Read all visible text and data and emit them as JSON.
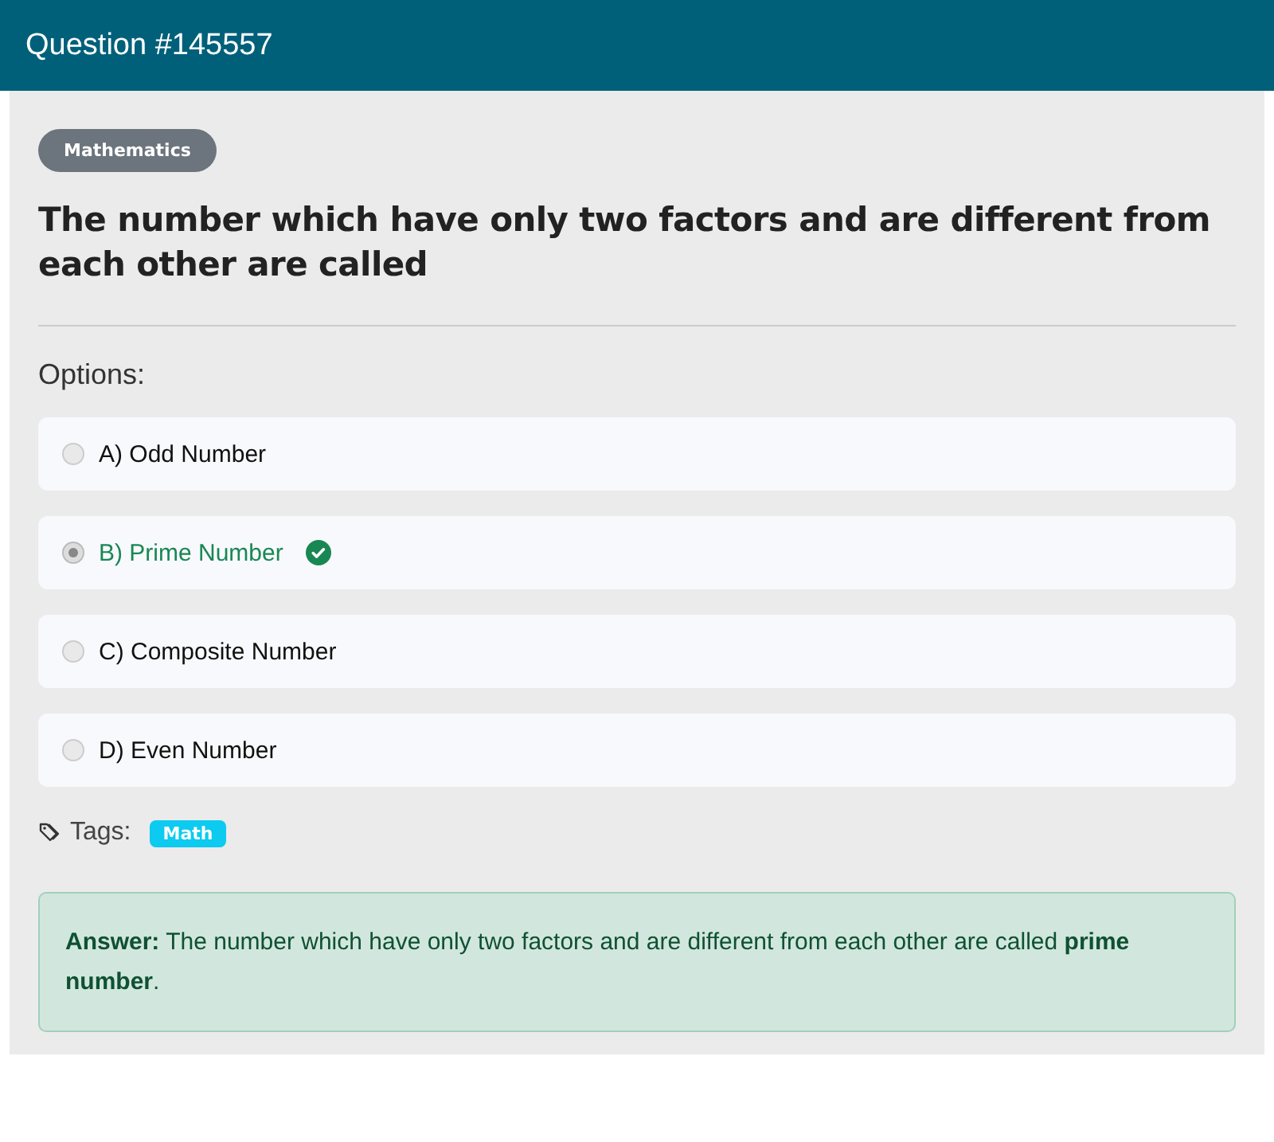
{
  "header": {
    "title": "Question #145557"
  },
  "category": "Mathematics",
  "question": "The number which have only two factors and are different from each other are called",
  "options_label": "Options:",
  "options": [
    {
      "label": "A) Odd Number",
      "selected": false,
      "correct": false
    },
    {
      "label": "B) Prime Number",
      "selected": true,
      "correct": true
    },
    {
      "label": "C) Composite Number",
      "selected": false,
      "correct": false
    },
    {
      "label": "D) Even Number",
      "selected": false,
      "correct": false
    }
  ],
  "tags_label": "Tags:",
  "tags": [
    "Math"
  ],
  "answer": "**Answer:** The number which have only two factors and are different from each other are called **prime number**."
}
